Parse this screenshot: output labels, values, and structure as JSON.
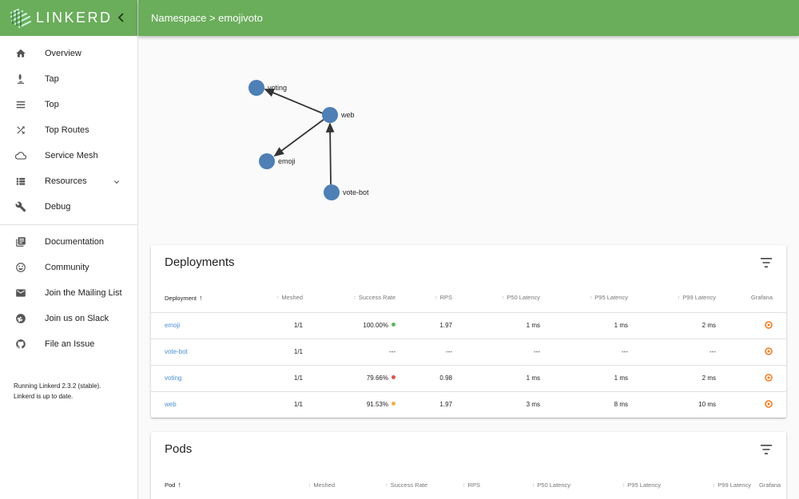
{
  "brand": {
    "name": "LINKERD",
    "collapse_icon": "chevron-left-icon"
  },
  "header": {
    "title": "Namespace > emojivoto"
  },
  "sidebar": {
    "primary": [
      {
        "label": "Overview",
        "icon": "home-icon"
      },
      {
        "label": "Tap",
        "icon": "microscope-icon"
      },
      {
        "label": "Top",
        "icon": "list-icon"
      },
      {
        "label": "Top Routes",
        "icon": "shuffle-icon"
      },
      {
        "label": "Service Mesh",
        "icon": "cloud-icon"
      },
      {
        "label": "Resources",
        "icon": "view-list-icon"
      },
      {
        "label": "Debug",
        "icon": "wrench-icon"
      }
    ],
    "secondary": [
      {
        "label": "Documentation",
        "icon": "library-books-icon"
      },
      {
        "label": "Community",
        "icon": "smiley-icon"
      },
      {
        "label": "Join the Mailing List",
        "icon": "email-icon"
      },
      {
        "label": "Join us on Slack",
        "icon": "slack-icon"
      },
      {
        "label": "File an Issue",
        "icon": "github-icon"
      }
    ],
    "version_line1": "Running Linkerd 2.3.2 (stable).",
    "version_line2": "Linkerd is up to date."
  },
  "graph": {
    "nodes": [
      "voting",
      "web",
      "emoji",
      "vote-bot"
    ],
    "edges": [
      [
        "web",
        "voting"
      ],
      [
        "web",
        "emoji"
      ],
      [
        "vote-bot",
        "web"
      ]
    ],
    "node_color": "#4e7fb5"
  },
  "deployments": {
    "title": "Deployments",
    "columns": [
      "Deployment",
      "Meshed",
      "Success Rate",
      "RPS",
      "P50 Latency",
      "P95 Latency",
      "P99 Latency",
      "Grafana"
    ],
    "rows": [
      {
        "name": "emoji",
        "meshed": "1/1",
        "success": "100.00%",
        "status": "#5cb85c",
        "rps": "1.97",
        "p50": "1 ms",
        "p95": "1 ms",
        "p99": "2 ms"
      },
      {
        "name": "vote-bot",
        "meshed": "1/1",
        "success": "---",
        "status": "",
        "rps": "---",
        "p50": "---",
        "p95": "---",
        "p99": "---"
      },
      {
        "name": "voting",
        "meshed": "1/1",
        "success": "79.66%",
        "status": "#d9534f",
        "rps": "0.98",
        "p50": "1 ms",
        "p95": "1 ms",
        "p99": "2 ms"
      },
      {
        "name": "web",
        "meshed": "1/1",
        "success": "91.53%",
        "status": "#f0ad4e",
        "rps": "1.97",
        "p50": "3 ms",
        "p95": "8 ms",
        "p99": "10 ms"
      }
    ]
  },
  "pods": {
    "title": "Pods",
    "columns": [
      "Pod",
      "Meshed",
      "Success Rate",
      "RPS",
      "P50 Latency",
      "P95 Latency",
      "P99 Latency",
      "Grafana"
    ]
  },
  "colors": {
    "brand_green": "#6aad5b",
    "link_blue": "#4a8fd1",
    "grafana_orange": "#f47a20"
  }
}
